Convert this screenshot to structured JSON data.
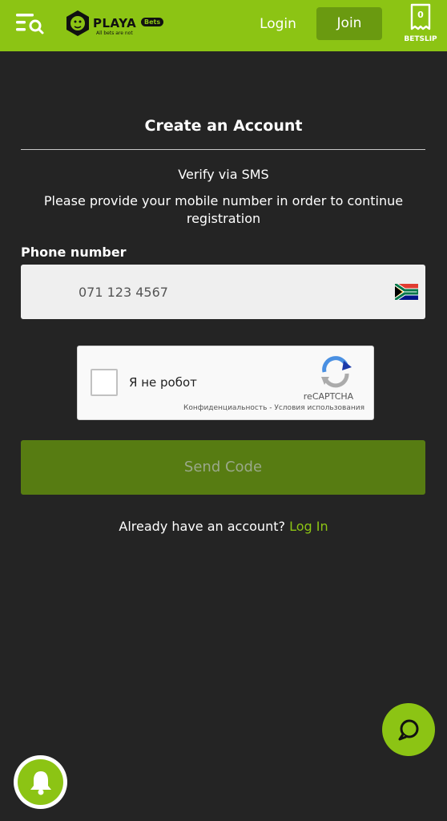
{
  "header": {
    "logo_text": "PLAYA",
    "logo_badge": "Bets",
    "logo_tagline": "All bets are not",
    "login_label": "Login",
    "join_label": "Join",
    "betslip_count": "0",
    "betslip_label": "BETSLIP",
    "accent_color": "#8cc414"
  },
  "form": {
    "title": "Create an Account",
    "verify_heading": "Verify via SMS",
    "instructions": "Please provide your mobile number in order to continue registration",
    "phone_label": "Phone number",
    "phone_placeholder": "071 123 4567",
    "phone_value": "",
    "country_flag": "south-africa-flag",
    "send_code_label": "Send Code",
    "already_text": "Already have an account?",
    "login_link": "Log In"
  },
  "captcha": {
    "label": "Я не робот",
    "brand": "reCAPTCHA",
    "privacy": "Конфиденциальность",
    "separator": "-",
    "terms": "Условия использования"
  },
  "widgets": {
    "chat_icon": "chat-bubble-icon",
    "notification_icon": "bell-icon"
  }
}
